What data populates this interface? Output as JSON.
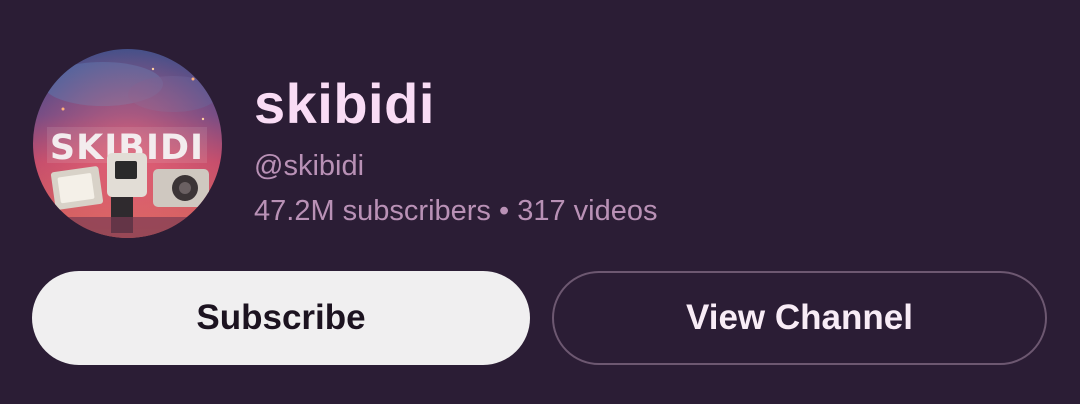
{
  "channel": {
    "name": "skibidi",
    "handle": "@skibidi",
    "stats": "47.2M subscribers • 317 videos",
    "avatar_logo_text": "SKIBIDI"
  },
  "actions": {
    "subscribe_label": "Subscribe",
    "view_channel_label": "View Channel"
  },
  "colors": {
    "background": "#2b1d35",
    "name": "#f9dcf5",
    "secondary_text": "#b991b6",
    "subscribe_bg": "#f0eff0",
    "outline": "#6d5871"
  }
}
